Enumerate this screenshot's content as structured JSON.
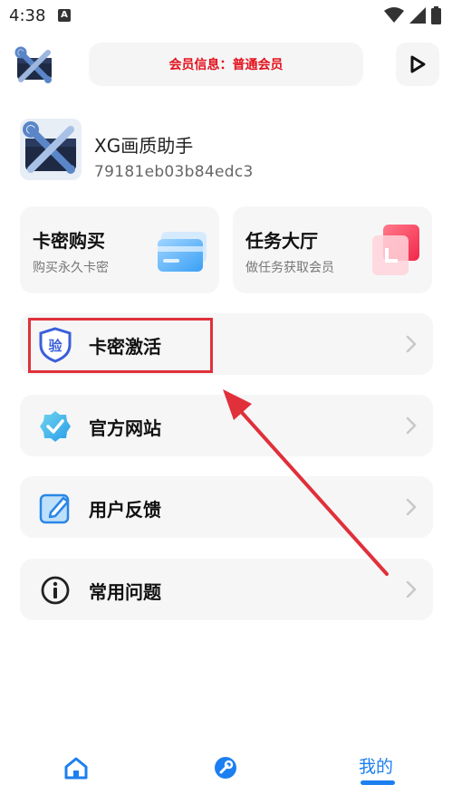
{
  "status_bar": {
    "time": "4:38",
    "notification_badge": "A"
  },
  "header": {
    "member_info": "会员信息：普通会员"
  },
  "profile": {
    "name": "XG画质助手",
    "id": "79181eb03b84edc3"
  },
  "quick_cards": [
    {
      "title": "卡密购买",
      "subtitle": "购买永久卡密"
    },
    {
      "title": "任务大厅",
      "subtitle": "做任务获取会员"
    }
  ],
  "menu": [
    {
      "label": "卡密激活",
      "icon": "verify-shield-icon",
      "icon_glyph": "验"
    },
    {
      "label": "官方网站",
      "icon": "badge-check-icon"
    },
    {
      "label": "用户反馈",
      "icon": "edit-icon"
    },
    {
      "label": "常用问题",
      "icon": "info-icon"
    }
  ],
  "bottom_nav": {
    "home_icon": "home-icon",
    "tools_icon": "wrench-icon",
    "mine_label": "我的"
  },
  "colors": {
    "accent": "#1c7ff0",
    "member_text": "#e3101b",
    "annotation_red": "#e0303a"
  }
}
